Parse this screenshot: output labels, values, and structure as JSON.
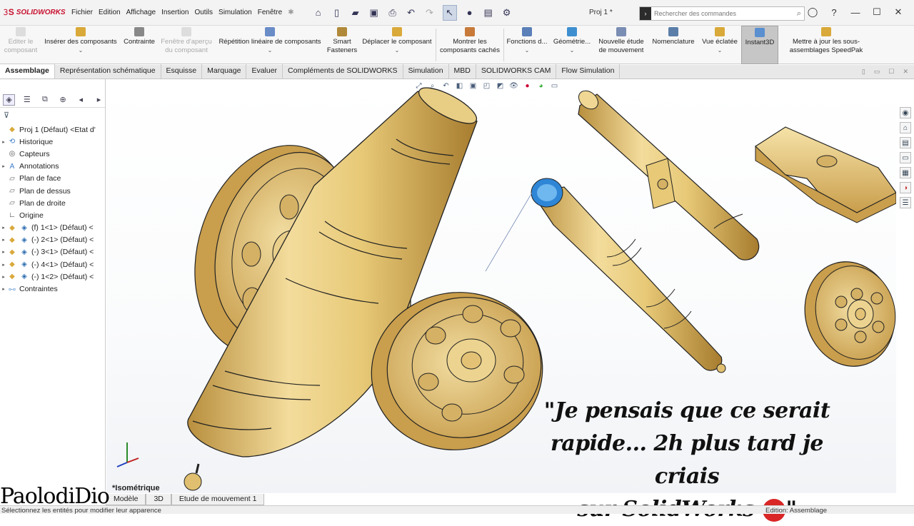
{
  "app": {
    "brand": "SOLIDWORKS",
    "doc_title": "Proj 1 *"
  },
  "menu": [
    "Fichier",
    "Edition",
    "Affichage",
    "Insertion",
    "Outils",
    "Simulation",
    "Fenêtre"
  ],
  "search": {
    "placeholder": "Rechercher des commandes"
  },
  "ribbon": [
    {
      "label": "Editer le composant",
      "disabled": true
    },
    {
      "label": "Insérer des composants"
    },
    {
      "label": "Contrainte"
    },
    {
      "label": "Fenêtre d'aperçu du composant",
      "disabled": true
    },
    {
      "label": "Répétition linéaire de composants"
    },
    {
      "label": "Smart Fasteners"
    },
    {
      "label": "Déplacer le composant"
    },
    {
      "label": "Montrer les composants cachés"
    },
    {
      "label": "Fonctions d..."
    },
    {
      "label": "Géométrie..."
    },
    {
      "label": "Nouvelle étude de mouvement"
    },
    {
      "label": "Nomenclature"
    },
    {
      "label": "Vue éclatée"
    },
    {
      "label": "Instant3D",
      "active": true
    },
    {
      "label": "Mettre à jour les sous-assemblages SpeedPak"
    }
  ],
  "tabs": [
    "Assemblage",
    "Représentation schématique",
    "Esquisse",
    "Marquage",
    "Evaluer",
    "Compléments de SOLIDWORKS",
    "Simulation",
    "MBD",
    "SOLIDWORKS CAM",
    "Flow Simulation"
  ],
  "tree": [
    {
      "label": "Proj 1 (Défaut) <Etat d'",
      "exp": false
    },
    {
      "label": "Historique",
      "exp": true
    },
    {
      "label": "Capteurs",
      "exp": false
    },
    {
      "label": "Annotations",
      "exp": true
    },
    {
      "label": "Plan de face",
      "exp": false
    },
    {
      "label": "Plan de dessus",
      "exp": false
    },
    {
      "label": "Plan de droite",
      "exp": false
    },
    {
      "label": "Origine",
      "exp": false
    },
    {
      "label": "(f) 1<1> (Défaut) <",
      "exp": true
    },
    {
      "label": "(-) 2<1> (Défaut) <",
      "exp": true
    },
    {
      "label": "(-) 3<1> (Défaut) <",
      "exp": true
    },
    {
      "label": "(-) 4<1> (Défaut) <",
      "exp": true
    },
    {
      "label": "(-) 1<2> (Défaut) <",
      "exp": true
    },
    {
      "label": "Contraintes",
      "exp": true
    }
  ],
  "viewport": {
    "view_label": "*Isométrique"
  },
  "overlay": {
    "quote_line1": "\"Je pensais que ce serait",
    "quote_line2": "rapide... 2h plus tard je criais",
    "quote_line3": "sur SolidWorks",
    "quote_end": "\"",
    "emoji_text": "#%!&",
    "watermark": "PaolodiDio"
  },
  "bottom_tabs": [
    "Modèle",
    "3D",
    "Etude de mouvement 1"
  ],
  "status": {
    "left": "Sélectionnez les entités pour modifier leur apparence",
    "right": "Edition: Assemblage"
  },
  "colors": {
    "accent": "#c8102e",
    "gold": "#e6c67a"
  }
}
